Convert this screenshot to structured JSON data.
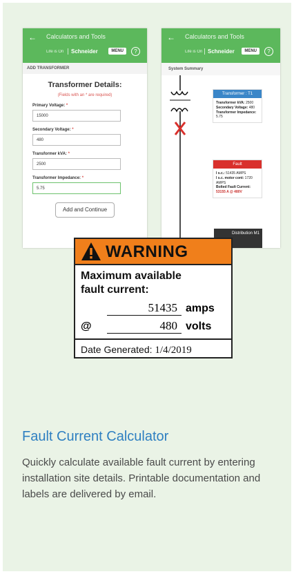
{
  "left_screen": {
    "app_title": "Calculators and Tools",
    "tagline": "Life is On",
    "brand": "Schneider",
    "menu_label": "MENU",
    "help_glyph": "?",
    "section_label": "ADD TRANSFORMER",
    "form_title": "Transformer Details:",
    "required_note": "(Fields with an * are required)",
    "fields": [
      {
        "label": "Primary Voltage:",
        "required": "*",
        "value": "15000"
      },
      {
        "label": "Secondary Voltage:",
        "required": "*",
        "value": "480"
      },
      {
        "label": "Transformer kVA:",
        "required": "*",
        "value": "2500"
      },
      {
        "label": "Transformer Impedance:",
        "required": "*",
        "value": "5.75"
      }
    ],
    "submit_label": "Add and Continue"
  },
  "right_screen": {
    "app_title": "Calculators and Tools",
    "tagline": "Life is On",
    "brand": "Schneider",
    "menu_label": "MENU",
    "help_glyph": "?",
    "section_label": "System Summary",
    "transformer_box": {
      "title": "Transformer : T1",
      "kva_label": "Transformer kVA:",
      "kva_value": "2500",
      "sec_label": "Secondary Voltage:",
      "sec_value": "480",
      "imp_label": "Transformer Impedance:",
      "imp_value": "5.75"
    },
    "fault_box": {
      "title": "Fault",
      "isc_label": "I s.c.:",
      "isc_value": "51435 AMPS",
      "motor_label": "I s.c. motor cont:",
      "motor_value": "1720 AMPS",
      "bolted_label": "Bolted Fault Current:",
      "bolted_value": "53155 A @ 480V"
    },
    "dark_box_label": "Distribution M1"
  },
  "warning_label": {
    "header": "WARNING",
    "message_line1": "Maximum available",
    "message_line2": "fault current:",
    "amps_value": "51435",
    "amps_unit": "amps",
    "at_symbol": "@",
    "volts_value": "480",
    "volts_unit": "volts",
    "date_label": "Date Generated:",
    "date_value": "1/4/2019"
  },
  "heading": "Fault Current Calculator",
  "description": "Quickly calculate available fault current by entering installation site details. Printable documentation and labels are delivered by email.",
  "colors": {
    "card_bg": "#eaf3e6",
    "app_green": "#5cb85c",
    "heading_blue": "#2e7fc1",
    "warning_orange": "#f07f1b",
    "transformer_blue": "#3a86c8",
    "fault_red": "#d9302c"
  },
  "icons": {
    "back": "arrow-left-icon",
    "help": "question-circle-icon",
    "warning": "warning-triangle-icon"
  }
}
